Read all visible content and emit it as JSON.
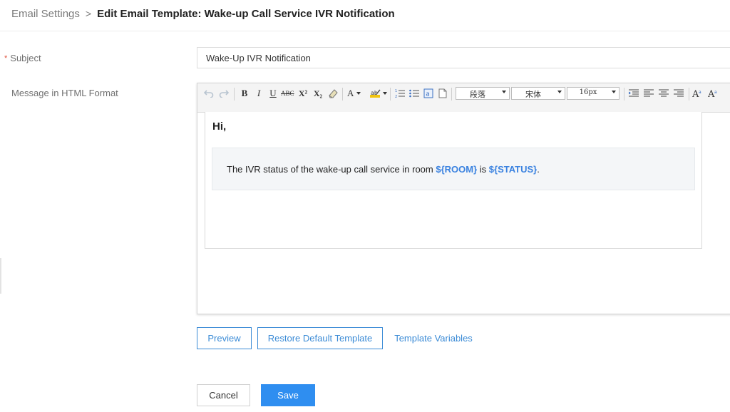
{
  "breadcrumb": {
    "root": "Email Settings",
    "separator": ">",
    "current": "Edit Email Template: Wake-up Call Service IVR Notification"
  },
  "form": {
    "subject_label": "Subject",
    "required_marker": "*",
    "subject_value": "Wake-Up IVR Notification",
    "message_label": "Message in HTML Format"
  },
  "toolbar": {
    "undo_icon": "undo-icon",
    "redo_icon": "redo-icon",
    "bold": "B",
    "italic": "I",
    "underline": "U",
    "strikethrough": "ABC",
    "superscript": "X²",
    "subscript": "X₂",
    "font_color": "A",
    "paragraph_select": "段落",
    "font_select": "宋体",
    "size_select": "16px"
  },
  "editor": {
    "greeting": "Hi,",
    "message_prefix": "The IVR status of the wake-up call service in room ",
    "var_room": "${ROOM}",
    "message_middle": " is ",
    "var_status": "${STATUS}",
    "message_suffix": "."
  },
  "actions": {
    "preview": "Preview",
    "restore_default": "Restore Default Template",
    "template_variables": "Template Variables",
    "cancel": "Cancel",
    "save": "Save"
  },
  "colors": {
    "accent": "#3b8bd6",
    "save_button": "#2f8ef0",
    "variable": "#3a82e0",
    "required": "#e0533f"
  }
}
